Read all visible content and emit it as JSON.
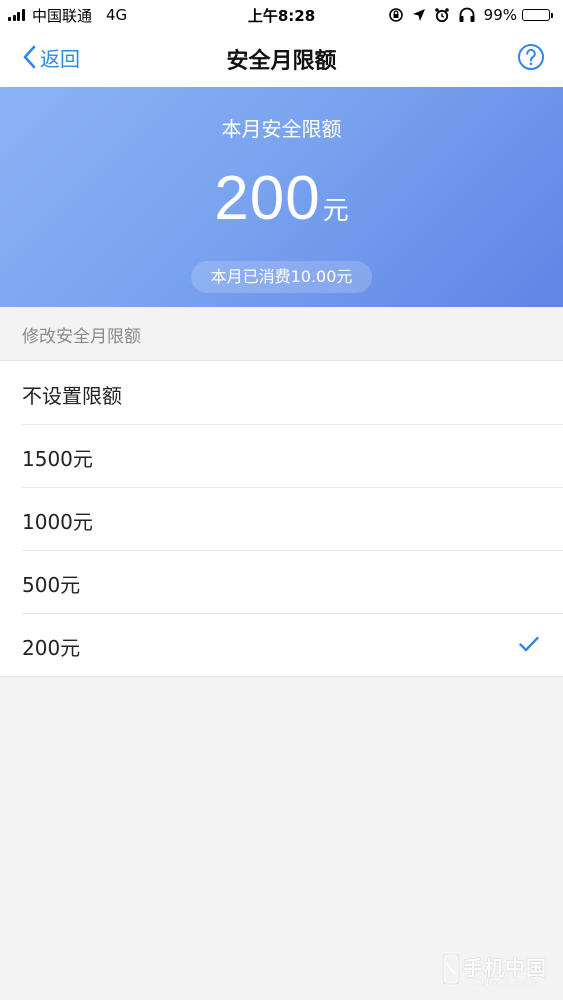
{
  "status_bar": {
    "carrier": "中国联通",
    "network": "4G",
    "time": "上午8:28",
    "battery_text": "99%",
    "battery_level": 0.99
  },
  "nav": {
    "back_label": "返回",
    "title": "安全月限额"
  },
  "hero": {
    "caption": "本月安全限额",
    "amount": "200",
    "unit": "元",
    "spent_text": "本月已消费10.00元"
  },
  "section": {
    "title": "修改安全月限额"
  },
  "options": [
    {
      "label": "不设置限额",
      "selected": false
    },
    {
      "label": "1500元",
      "selected": false
    },
    {
      "label": "1000元",
      "selected": false
    },
    {
      "label": "500元",
      "selected": false
    },
    {
      "label": "200元",
      "selected": true
    }
  ],
  "colors": {
    "accent": "#2f87e6",
    "hero_start": "#8db3f6",
    "hero_end": "#5f85e6",
    "background": "#f3f3f3"
  },
  "watermark": {
    "text": "手机中国",
    "sub": "CNMO.com"
  }
}
